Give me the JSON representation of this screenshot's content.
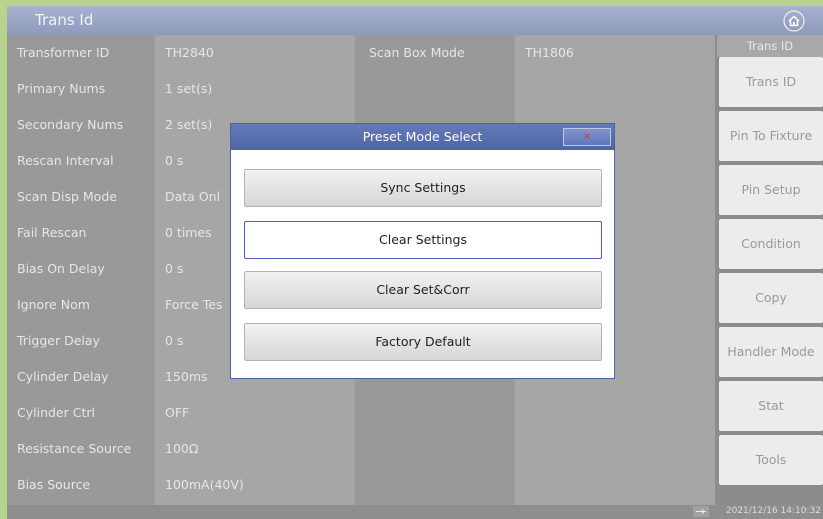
{
  "header": {
    "title": "Trans Id",
    "home_icon": "home-icon"
  },
  "params": [
    {
      "label": "Transformer ID",
      "value": "TH2840",
      "label2": "Scan Box Mode",
      "value2": "TH1806"
    },
    {
      "label": "Primary Nums",
      "value": "1 set(s)",
      "label2": "",
      "value2": ""
    },
    {
      "label": "Secondary Nums",
      "value": "2 set(s)",
      "label2": "",
      "value2": ""
    },
    {
      "label": "Rescan Interval",
      "value": "0 s",
      "label2": "",
      "value2": ""
    },
    {
      "label": "Scan Disp Mode",
      "value": "Data Onl",
      "label2": "",
      "value2": ""
    },
    {
      "label": "Fail Rescan",
      "value": "0 times",
      "label2": "",
      "value2": ""
    },
    {
      "label": "Bias On Delay",
      "value": "0 s",
      "label2": "",
      "value2": ""
    },
    {
      "label": "Ignore Nom",
      "value": "Force Tes",
      "label2": "",
      "value2": ""
    },
    {
      "label": "Trigger Delay",
      "value": "0 s",
      "label2": "",
      "value2": ""
    },
    {
      "label": "Cylinder Delay",
      "value": "150ms",
      "label2": "",
      "value2": ""
    },
    {
      "label": "Cylinder Ctrl",
      "value": "OFF",
      "label2": "",
      "value2": ""
    },
    {
      "label": "Resistance Source",
      "value": "100Ω",
      "label2": "",
      "value2": ""
    },
    {
      "label": "Bias Source",
      "value": "100mA(40V)",
      "label2": "",
      "value2": ""
    }
  ],
  "sidebar": {
    "heading": "Trans ID",
    "buttons": [
      "Trans ID",
      "Pin To Fixture",
      "Pin Setup",
      "Condition",
      "Copy",
      "Handler Mode",
      "Stat",
      "Tools"
    ]
  },
  "dialog": {
    "title": "Preset Mode Select",
    "close_symbol": "×",
    "options": [
      "Sync Settings",
      "Clear Settings",
      "Clear Set&Corr",
      "Factory Default"
    ],
    "selected_index": 1
  },
  "status": {
    "usb_icon": "usb-icon",
    "datetime": "2021/12/16 14:10:32"
  },
  "colors": {
    "title_bar": "#96a3c5",
    "dialog_header": "#5569ac",
    "selected_border": "#4a5fc0"
  }
}
